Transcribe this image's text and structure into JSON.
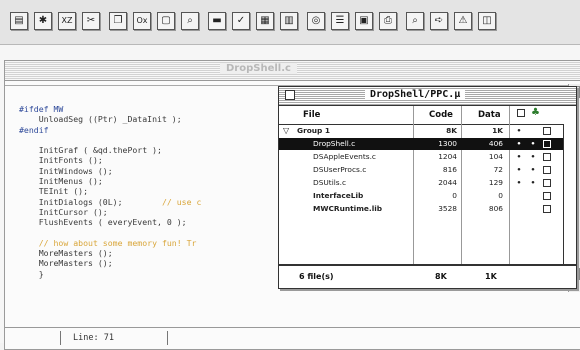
{
  "toolbar": {
    "buttons": [
      {
        "icon": "save-icon",
        "label": ""
      },
      {
        "icon": "debug-icon",
        "label": ""
      },
      {
        "icon": "cut-icon",
        "label": "XZ"
      },
      {
        "icon": "scissors-icon",
        "label": ""
      },
      {
        "icon": "copy-icon",
        "label": ""
      },
      {
        "icon": "paste-icon",
        "label": "Ox"
      },
      {
        "icon": "clear-icon",
        "label": ""
      },
      {
        "icon": "find-icon",
        "label": ""
      },
      {
        "icon": "compile-icon",
        "label": ""
      },
      {
        "icon": "check-syntax-icon",
        "label": ""
      },
      {
        "icon": "make-icon",
        "label": ""
      },
      {
        "icon": "bring-up-to-date-icon",
        "label": ""
      },
      {
        "icon": "run-icon",
        "label": ""
      },
      {
        "icon": "file-list-icon",
        "label": ""
      },
      {
        "icon": "header-icon",
        "label": ""
      },
      {
        "icon": "print-icon",
        "label": ""
      },
      {
        "icon": "search-icon",
        "label": ""
      },
      {
        "icon": "arrow-icon",
        "label": ""
      },
      {
        "icon": "warning-icon",
        "label": ""
      },
      {
        "icon": "window-icon",
        "label": ""
      }
    ]
  },
  "editor": {
    "title": "DropShell.c",
    "line_status": "Line: 71",
    "code_lines": [
      {
        "text": "#ifdef MW",
        "kind": "pp"
      },
      {
        "text": "    UnloadSeg ((Ptr) _DataInit );",
        "kind": "code"
      },
      {
        "text": "#endif",
        "kind": "pp"
      },
      {
        "text": "",
        "kind": "code"
      },
      {
        "text": "    InitGraf ( &qd.thePort );",
        "kind": "code"
      },
      {
        "text": "    InitFonts ();",
        "kind": "code"
      },
      {
        "text": "    InitWindows ();",
        "kind": "code"
      },
      {
        "text": "    InitMenus ();",
        "kind": "code"
      },
      {
        "text": "    TEInit ();",
        "kind": "code"
      },
      {
        "text": "    InitDialogs (0L);        // use c",
        "kind": "mixed"
      },
      {
        "text": "    InitCursor ();",
        "kind": "code"
      },
      {
        "text": "    FlushEvents ( everyEvent, 0 );",
        "kind": "code"
      },
      {
        "text": "",
        "kind": "code"
      },
      {
        "text": "    // how about some memory fun! Tr",
        "kind": "cm"
      },
      {
        "text": "    MoreMasters ();",
        "kind": "code"
      },
      {
        "text": "    MoreMasters ();",
        "kind": "code"
      },
      {
        "text": "    }",
        "kind": "code"
      }
    ]
  },
  "project": {
    "title": "DropShell/PPC.μ",
    "headers": {
      "file": "File",
      "code": "Code",
      "data": "Data"
    },
    "rows": [
      {
        "name": "Group 1",
        "code": "8K",
        "data": "1K",
        "dot": "•",
        "dot2": "",
        "group": true,
        "selected": false
      },
      {
        "name": "DropShell.c",
        "code": "1300",
        "data": "406",
        "dot": "•",
        "dot2": "•",
        "group": false,
        "selected": true
      },
      {
        "name": "DSAppleEvents.c",
        "code": "1204",
        "data": "104",
        "dot": "•",
        "dot2": "•",
        "group": false,
        "selected": false
      },
      {
        "name": "DSUserProcs.c",
        "code": "816",
        "code_raw": "816",
        "data": "72",
        "dot": "•",
        "dot2": "•",
        "group": false,
        "selected": false
      },
      {
        "name": "DSUtils.c",
        "code": "2044",
        "data": "129",
        "dot": "•",
        "dot2": "•",
        "group": false,
        "selected": false
      },
      {
        "name": "InterfaceLib",
        "code": "0",
        "data": "0",
        "dot": "",
        "dot2": "",
        "group": false,
        "bold": true,
        "selected": false
      },
      {
        "name": "MWCRuntime.lib",
        "code": "3528",
        "data": "806",
        "dot": "",
        "dot2": "",
        "group": false,
        "bold": true,
        "selected": false
      }
    ],
    "footer": {
      "count": "6 file(s)",
      "code": "8K",
      "data": "1K"
    }
  }
}
